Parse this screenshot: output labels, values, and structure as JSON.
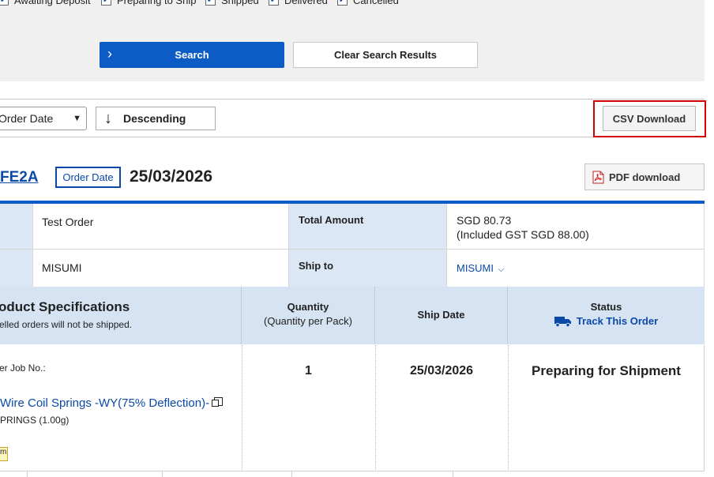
{
  "filters": {
    "statuses": [
      {
        "label": "Awaiting Deposit",
        "checked": true
      },
      {
        "label": "Preparing to Ship",
        "checked": true
      },
      {
        "label": "Shipped",
        "checked": true
      },
      {
        "label": "Delivered",
        "checked": true
      },
      {
        "label": "Cancelled",
        "checked": true
      }
    ],
    "search_label": "Search",
    "clear_label": "Clear Search Results"
  },
  "sort": {
    "field_value": "Order Date",
    "order_label": "Descending",
    "csv_label": "CSV Download"
  },
  "order": {
    "id_fragment": "FE2A",
    "date_badge": "Order Date",
    "date": "25/03/2026",
    "pdf_label": "PDF download",
    "order_name": "Test Order",
    "total_amount_label": "Total Amount",
    "total_amount": "SGD 80.73",
    "gst_note": "(Included GST SGD 88.00)",
    "company": "MISUMI",
    "ship_to_label": "Ship to",
    "ship_to_value": "MISUMI"
  },
  "product_table": {
    "spec_header": "oduct Specifications",
    "spec_note": "elled orders will not be shipped.",
    "qty_header": "Quantity",
    "qty_sub": "(Quantity per Pack)",
    "ship_header": "Ship Date",
    "status_header": "Status",
    "track_label": "Track This Order"
  },
  "item": {
    "job_label": "er Job No.:",
    "name": "Wire Coil Springs -WY(75% Deflection)-",
    "sub": "PRINGS (1.00g)",
    "tag": "m",
    "quantity": "1",
    "ship_date": "25/03/2026",
    "status": "Preparing for Shipment"
  },
  "colors": {
    "brand_blue": "#0b49a8",
    "search_button": "#0d5bc4",
    "highlight_red": "#d40000",
    "table_header": "#dbe7f5"
  }
}
